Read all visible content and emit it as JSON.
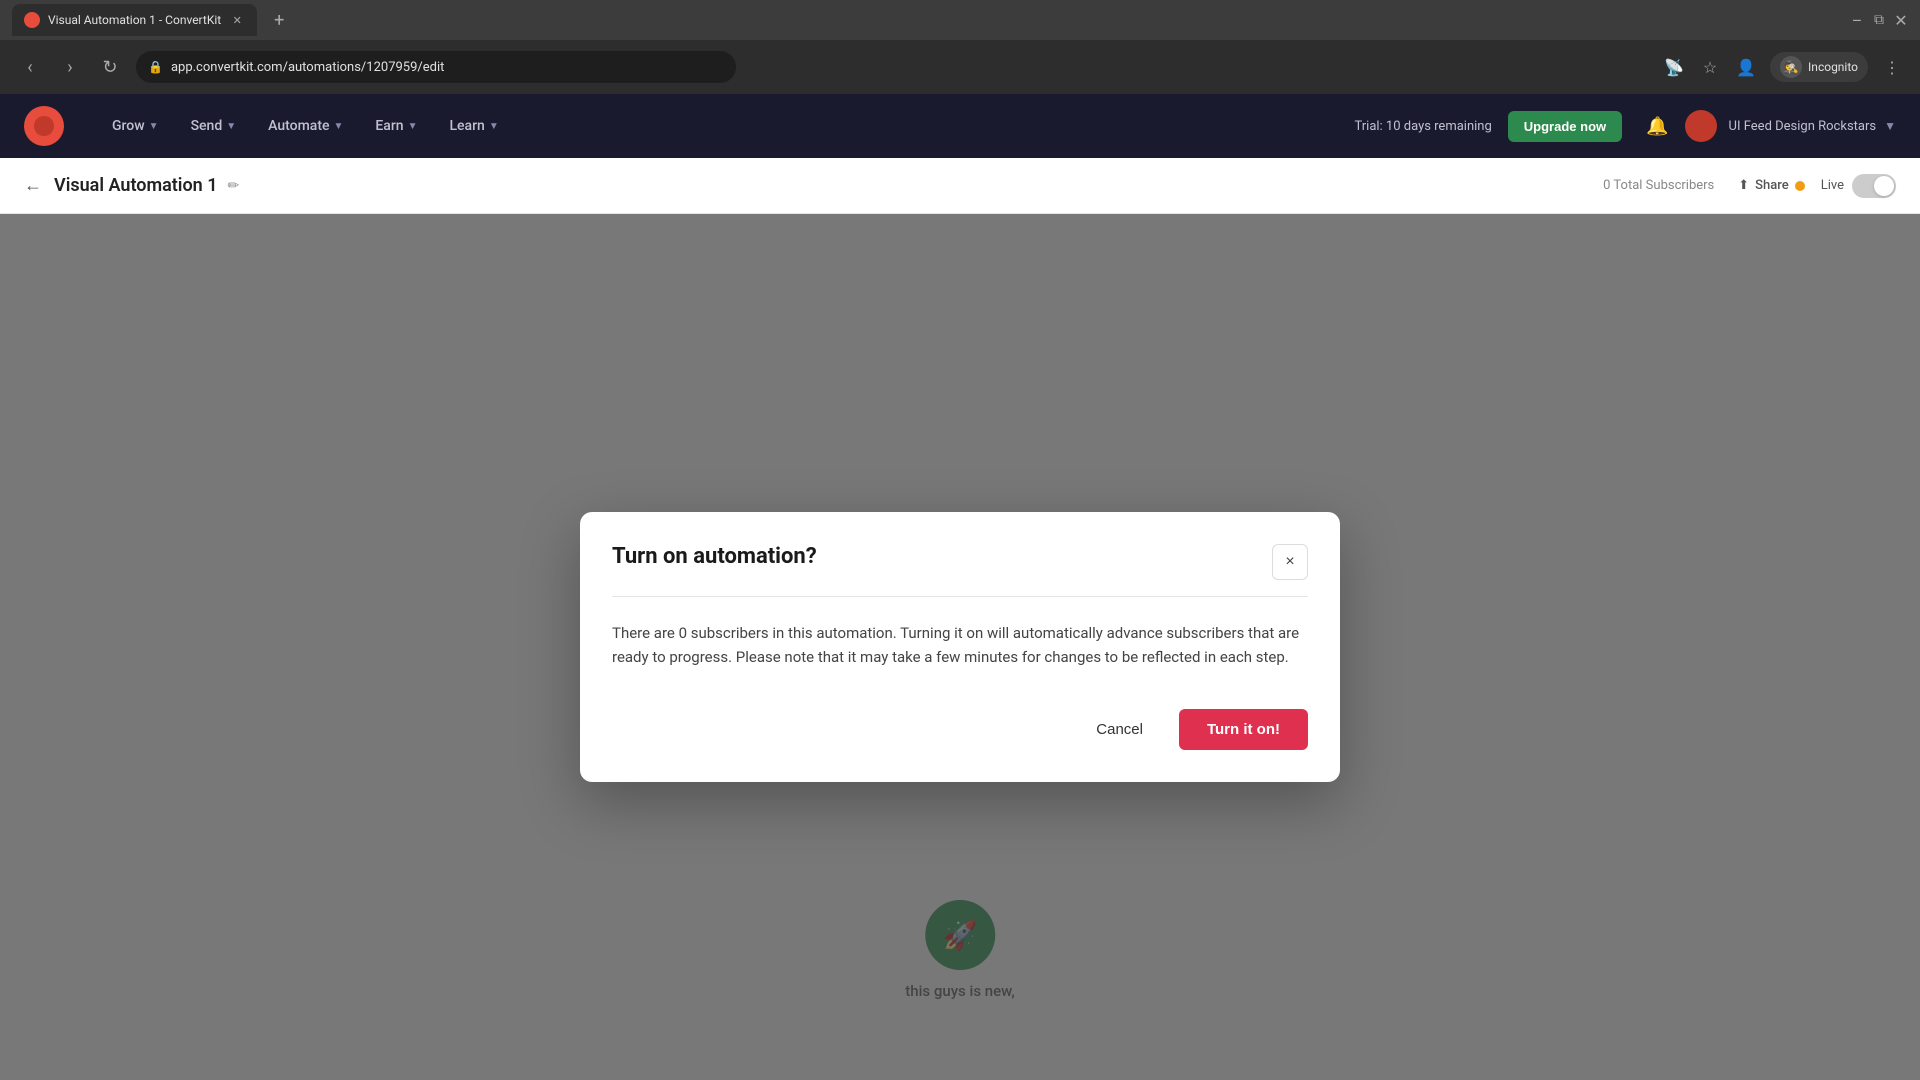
{
  "browser": {
    "tab": {
      "title": "Visual Automation 1 - ConvertKit",
      "favicon": "🔴"
    },
    "address": "app.convertkit.com/automations/1207959/edit",
    "incognito_label": "Incognito"
  },
  "nav": {
    "items": [
      {
        "label": "Grow",
        "id": "grow"
      },
      {
        "label": "Send",
        "id": "send"
      },
      {
        "label": "Automate",
        "id": "automate"
      },
      {
        "label": "Earn",
        "id": "earn"
      },
      {
        "label": "Learn",
        "id": "learn"
      }
    ],
    "trial_text": "Trial: 10 days remaining",
    "upgrade_label": "Upgrade now",
    "username": "UI Feed Design Rockstars"
  },
  "sub_nav": {
    "back_label": "←",
    "automation_title": "Visual Automation 1",
    "subscribers_text": "0 Total Subscribers",
    "share_label": "Share",
    "live_label": "Live"
  },
  "dialog": {
    "title": "Turn on automation?",
    "close_label": "×",
    "body": "There are 0 subscribers in this automation. Turning it on will automatically advance subscribers that are ready to progress. Please note that it may take a few minutes for changes to be reflected in each step.",
    "cancel_label": "Cancel",
    "confirm_label": "Turn it on!"
  },
  "automation_node": {
    "icon": "🚀",
    "label": "this guys is new,"
  }
}
